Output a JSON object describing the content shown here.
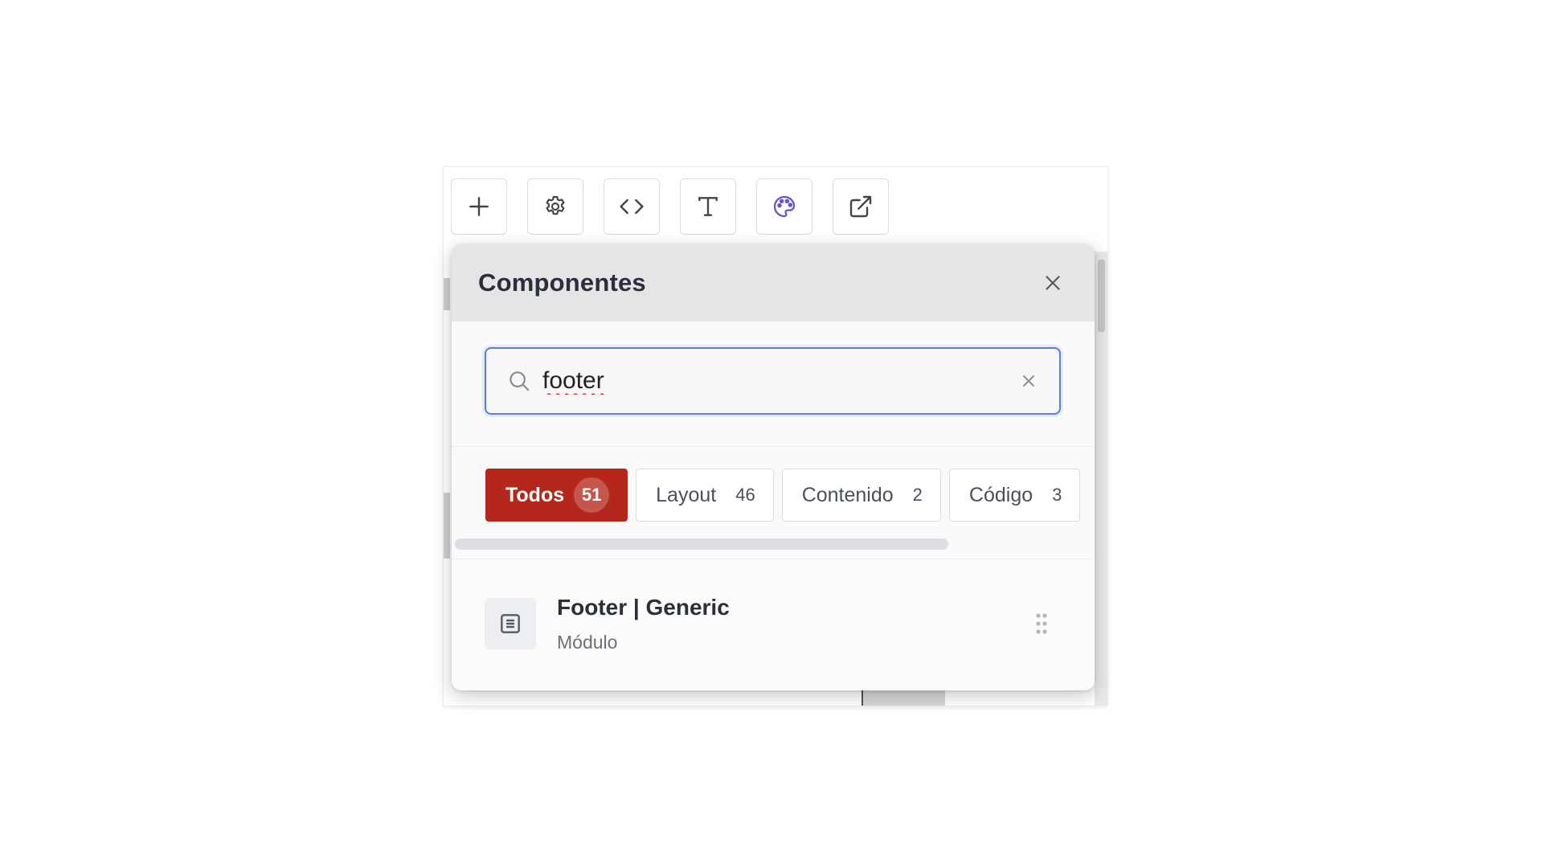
{
  "toolbar": {
    "buttons": [
      {
        "name": "add",
        "icon": "plus-icon"
      },
      {
        "name": "settings",
        "icon": "gear-icon"
      },
      {
        "name": "code",
        "icon": "code-icon"
      },
      {
        "name": "text",
        "icon": "text-icon"
      },
      {
        "name": "theme",
        "icon": "palette-icon",
        "accent": "#6b4fd6"
      },
      {
        "name": "open-external",
        "icon": "external-link-icon"
      }
    ]
  },
  "panel": {
    "title": "Componentes",
    "close_icon": "close-icon"
  },
  "search": {
    "value": "footer",
    "icon": "search-icon",
    "clear_icon": "clear-icon",
    "focus_color": "#5b7be6"
  },
  "filters": {
    "active_color": "#b5271b",
    "items": [
      {
        "label": "Todos",
        "count": "51",
        "active": true
      },
      {
        "label": "Layout",
        "count": "46",
        "active": false
      },
      {
        "label": "Contenido",
        "count": "2",
        "active": false
      },
      {
        "label": "Código",
        "count": "3",
        "active": false
      }
    ]
  },
  "results": [
    {
      "title": "Footer | Generic",
      "subtitle": "Módulo",
      "icon": "module-icon",
      "handle_icon": "drag-handle-icon"
    }
  ]
}
